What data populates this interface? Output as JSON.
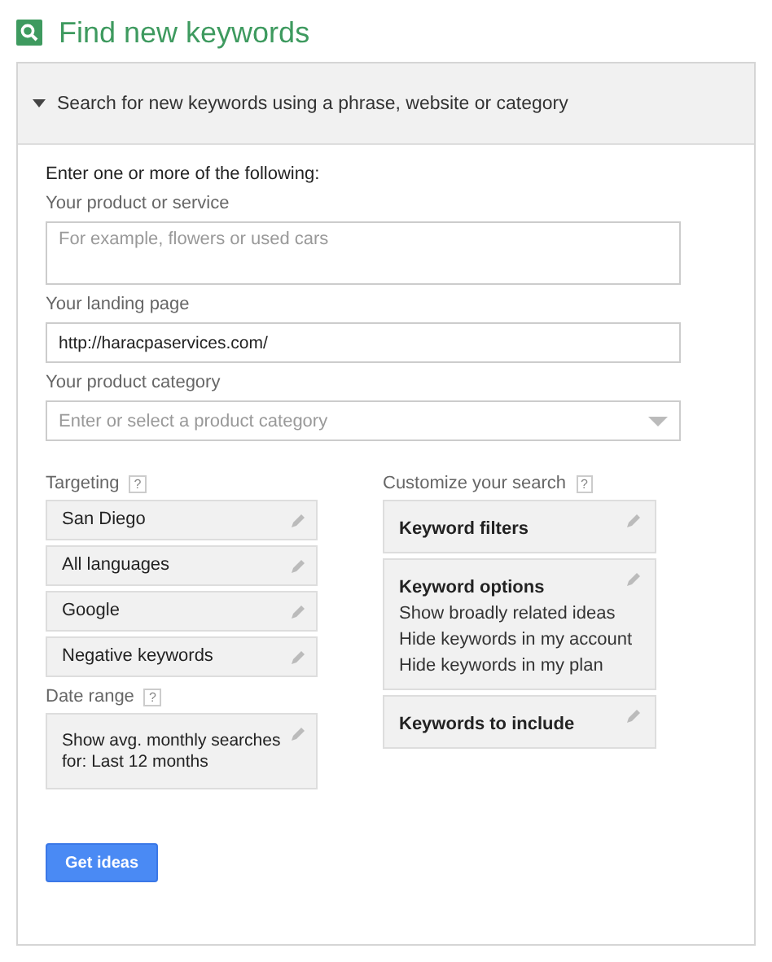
{
  "title": "Find new keywords",
  "section": {
    "heading": "Search for new keywords using a phrase, website or category",
    "expanded": true
  },
  "intro": "Enter one or more of the following:",
  "fields": [
    {
      "kind": "textarea",
      "label": "Your product or service",
      "placeholder": "For example, flowers or used cars"
    },
    {
      "kind": "text",
      "label": "Your landing page",
      "value": "http://haracpaservices.com/"
    },
    {
      "kind": "select",
      "label": "Your product category",
      "placeholder": "Enter or select a product category"
    }
  ],
  "targeting": {
    "label": "Targeting",
    "help": "?",
    "items": [
      "San Diego",
      "All languages",
      "Google",
      "Negative keywords"
    ]
  },
  "date_range": {
    "label": "Date range",
    "help": "?",
    "text": "Show avg. monthly searches for: Last 12 months"
  },
  "customize": {
    "label": "Customize your search",
    "help": "?",
    "items": [
      {
        "title": "Keyword filters"
      },
      {
        "title": "Keyword options",
        "lines": [
          "Show broadly related ideas",
          "Hide keywords in my account",
          "Hide keywords in my plan"
        ]
      },
      {
        "title": "Keywords to include"
      }
    ]
  },
  "button": "Get ideas"
}
